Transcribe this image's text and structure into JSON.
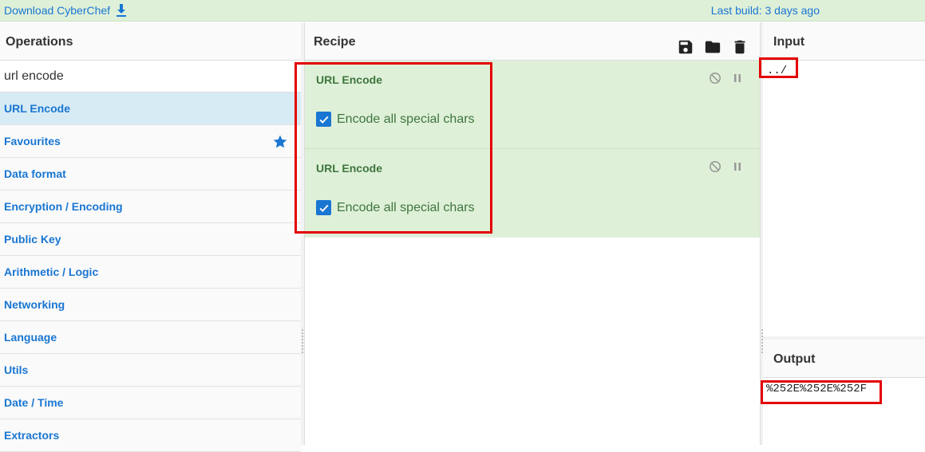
{
  "banner": {
    "download_label": "Download CyberChef",
    "last_build": "Last build: 3 days ago"
  },
  "operations": {
    "title": "Operations",
    "search_value": "url encode",
    "items": [
      {
        "label": "URL Encode",
        "selected": true
      },
      {
        "label": "Favourites",
        "icon": "star-icon"
      },
      {
        "label": "Data format"
      },
      {
        "label": "Encryption / Encoding"
      },
      {
        "label": "Public Key"
      },
      {
        "label": "Arithmetic / Logic"
      },
      {
        "label": "Networking"
      },
      {
        "label": "Language"
      },
      {
        "label": "Utils"
      },
      {
        "label": "Date / Time"
      },
      {
        "label": "Extractors"
      }
    ]
  },
  "recipe": {
    "title": "Recipe",
    "icons": [
      "save-icon",
      "folder-icon",
      "trash-icon"
    ],
    "ops": [
      {
        "name": "URL Encode",
        "arg_label": "Encode all special chars",
        "checked": true
      },
      {
        "name": "URL Encode",
        "arg_label": "Encode all special chars",
        "checked": true
      }
    ]
  },
  "input": {
    "title": "Input",
    "value": "../"
  },
  "output": {
    "title": "Output",
    "value": "%252E%252E%252F"
  },
  "colors": {
    "accent": "#1976d2",
    "recipe_bg": "#dff0d8",
    "recipe_text": "#3c763d",
    "highlight": "#e30000"
  }
}
